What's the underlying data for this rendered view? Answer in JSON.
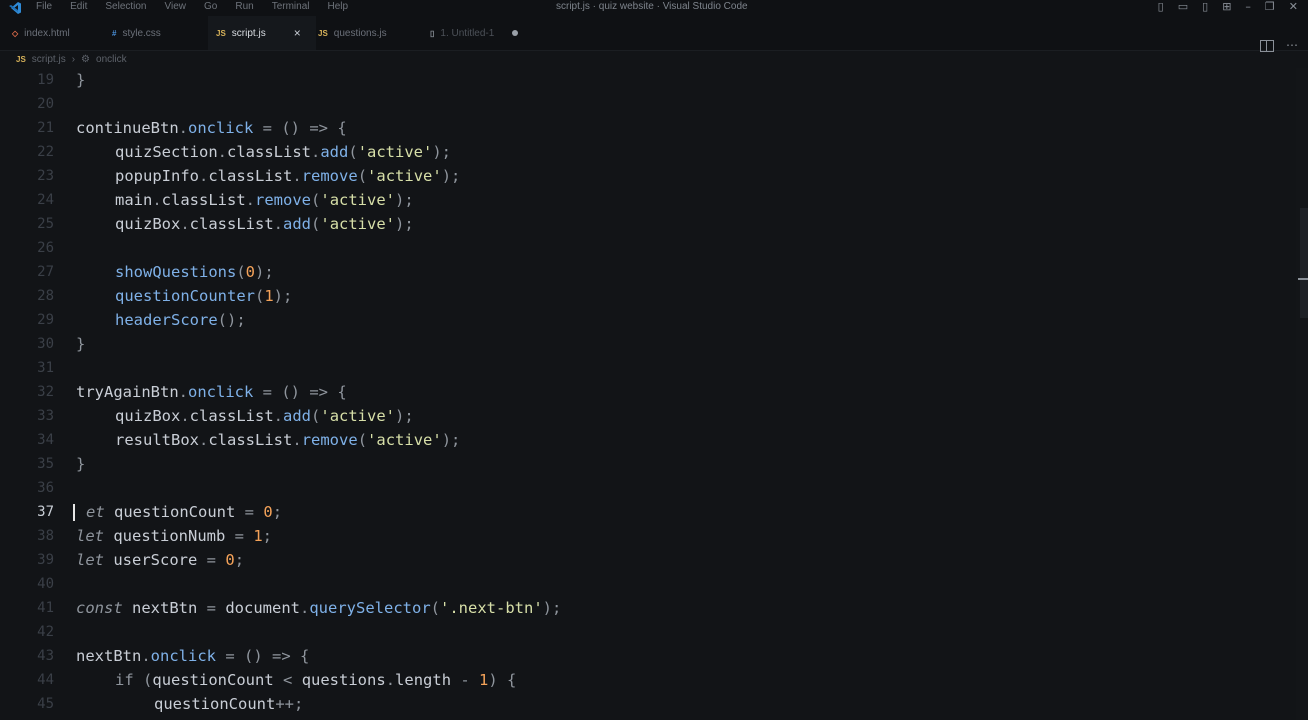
{
  "menu": [
    "File",
    "Edit",
    "Selection",
    "View",
    "Go",
    "Run",
    "Terminal",
    "Help"
  ],
  "window_title": "script.js · quiz website · Visual Studio Code",
  "tabs": [
    {
      "label": "index.html",
      "icon": "html-icon",
      "icon_text": "◇"
    },
    {
      "label": "style.css",
      "icon": "css-icon",
      "icon_text": "#"
    },
    {
      "label": "script.js",
      "icon": "js-icon",
      "icon_text": "JS",
      "close": "×"
    },
    {
      "label": "questions.js",
      "icon": "js-icon",
      "icon_text": "JS"
    },
    {
      "label": "1. Untitled-1",
      "icon": "file-icon",
      "icon_text": "▯"
    }
  ],
  "breadcrumb": {
    "file": "script.js",
    "sep": "›",
    "symbol": "onclick",
    "file_icon": "JS",
    "symbol_icon": "⚙"
  },
  "editor": {
    "current_line": 37,
    "lines": [
      {
        "n": "19"
      },
      {
        "n": "20"
      },
      {
        "n": "21"
      },
      {
        "n": "22"
      },
      {
        "n": "23"
      },
      {
        "n": "24"
      },
      {
        "n": "25"
      },
      {
        "n": "26"
      },
      {
        "n": "27"
      },
      {
        "n": "28"
      },
      {
        "n": "29"
      },
      {
        "n": "30"
      },
      {
        "n": "31"
      },
      {
        "n": "32"
      },
      {
        "n": "33"
      },
      {
        "n": "34"
      },
      {
        "n": "35"
      },
      {
        "n": "36"
      },
      {
        "n": "37"
      },
      {
        "n": "38"
      },
      {
        "n": "39"
      },
      {
        "n": "40"
      },
      {
        "n": "41"
      },
      {
        "n": "42"
      },
      {
        "n": "43"
      },
      {
        "n": "44"
      },
      {
        "n": "45"
      }
    ],
    "t": {
      "brace_close": "}",
      "continueBtn": "continueBtn",
      "onclick": "onclick",
      "arrow_fn": " = () => {",
      "quizSection": "quizSection",
      "popupInfo": "popupInfo",
      "main": "main",
      "quizBox": "quizBox",
      "resultBox": "resultBox",
      "classList": "classList",
      "add": "add",
      "remove": "remove",
      "active": "'active'",
      "showQuestions": "showQuestions",
      "questionCounter": "questionCounter",
      "headerScore": "headerScore",
      "tryAgainBtn": "tryAgainBtn",
      "let_cursor": "et",
      "let": "let",
      "const": "const",
      "questionCount": "questionCount",
      "questionNumb": "questionNumb",
      "userScore": "userScore",
      "nextBtn": "nextBtn",
      "document": "document",
      "querySelector": "querySelector",
      "next_btn_sel": "'.next-btn'",
      "zero": "0",
      "one": "1",
      "if": "if",
      "questions": "questions",
      "length": "length",
      "inc": "++;",
      "eq": " = ",
      "lt": " < ",
      "minus": " - ",
      "dot": ".",
      "paren_open": "(",
      "paren_close_semi": ");",
      "paren_close": ")",
      "parens_semi": "();",
      "semi": ";",
      "open_brace": " {"
    }
  }
}
